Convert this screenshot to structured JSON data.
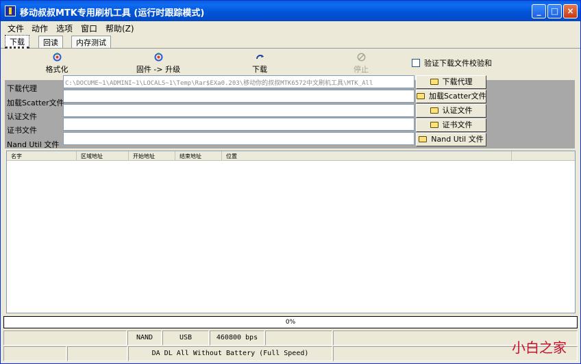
{
  "window": {
    "title": "移动叔叔MTK专用刷机工具 (运行时跟踪模式)",
    "min_label": "_",
    "max_label": "□",
    "close_label": "×"
  },
  "menu": [
    "文件",
    "动作",
    "选项",
    "窗口",
    "帮助(Z)"
  ],
  "tabs": [
    "下载",
    "回读",
    "内存测试"
  ],
  "toolbar": {
    "format": "格式化",
    "firmware_upgrade": "固件 -> 升级",
    "download": "下载",
    "stop": "停止",
    "verify_checksum": "验证下载文件校验和"
  },
  "files": {
    "rows": [
      {
        "label": "下载代理",
        "path": "C:\\DOCUME~1\\ADMINI~1\\LOCALS~1\\Temp\\Rar$EXa0.203\\移动你的叔叔MTK6572中文刷机工具\\MTK_All",
        "button": "下载代理"
      },
      {
        "label": "加载Scatter文件",
        "path": "",
        "button": "加载Scatter文件"
      },
      {
        "label": "认证文件",
        "path": "",
        "button": "认证文件"
      },
      {
        "label": "证书文件",
        "path": "",
        "button": "证书文件"
      },
      {
        "label": "Nand Util 文件",
        "path": "",
        "button": "Nand Util 文件"
      }
    ]
  },
  "list": {
    "columns": [
      "名字",
      "区域地址",
      "开始地址",
      "结束地址",
      "位置"
    ]
  },
  "progress": {
    "text": "0%",
    "value": 0
  },
  "status": {
    "row1": [
      "",
      "NAND",
      "USB",
      "460800 bps",
      "",
      ""
    ],
    "row2": [
      "",
      "",
      "DA DL All Without Battery (Full Speed)",
      ""
    ]
  },
  "watermark": "小白之家",
  "colors": {
    "title_blue": "#0254d8",
    "window_bg": "#ece9d8",
    "watermark_red": "#c8102e"
  }
}
